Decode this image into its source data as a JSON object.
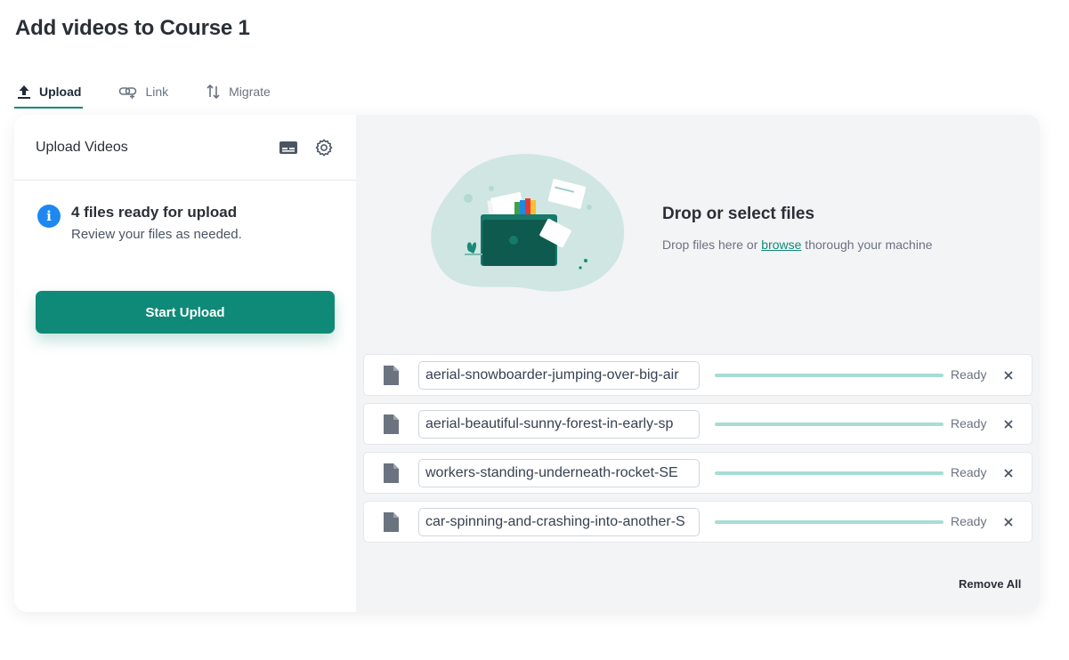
{
  "page": {
    "title": "Add videos to Course 1"
  },
  "tabs": [
    {
      "label": "Upload",
      "icon": "upload-icon",
      "active": true
    },
    {
      "label": "Link",
      "icon": "link-icon",
      "active": false
    },
    {
      "label": "Migrate",
      "icon": "migrate-icon",
      "active": false
    }
  ],
  "left_panel": {
    "title": "Upload Videos",
    "info_title": "4 files ready for upload",
    "info_subtitle": "Review your files as needed.",
    "start_button": "Start Upload"
  },
  "drop_zone": {
    "title": "Drop or select files",
    "text_before": "Drop files here or ",
    "link": "browse",
    "text_after": " thorough your machine"
  },
  "files": [
    {
      "name": "aerial-snowboarder-jumping-over-big-air",
      "status": "Ready",
      "progress": 1.0
    },
    {
      "name": "aerial-beautiful-sunny-forest-in-early-sp",
      "status": "Ready",
      "progress": 1.0
    },
    {
      "name": "workers-standing-underneath-rocket-SE",
      "status": "Ready",
      "progress": 1.0
    },
    {
      "name": "car-spinning-and-crashing-into-another-S",
      "status": "Ready",
      "progress": 1.0
    }
  ],
  "footer": {
    "remove_all": "Remove All"
  },
  "colors": {
    "accent": "#0f8a78",
    "info": "#1e88f0",
    "progress": "#a7ddd4"
  }
}
